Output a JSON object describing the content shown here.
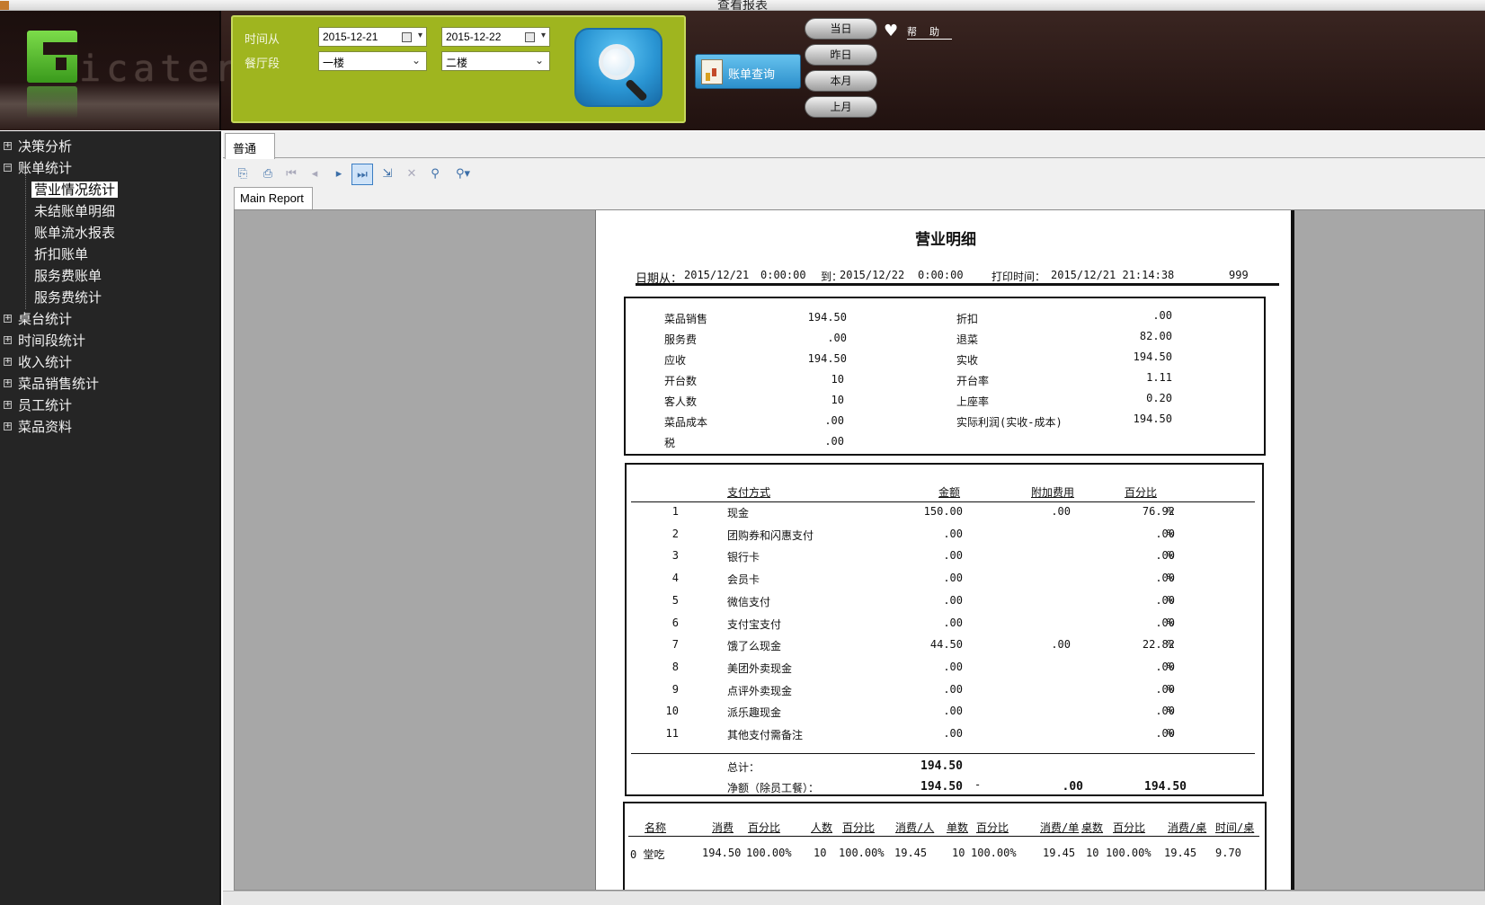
{
  "window": {
    "title": "查看报表"
  },
  "logo": {
    "text": "icater"
  },
  "filters": {
    "time_from_label": "时间从",
    "date_from": "2015-12-21",
    "date_to": "2015-12-22",
    "section_label": "餐厅段",
    "section_from": "一楼",
    "section_to": "二楼"
  },
  "buttons": {
    "bill_query": "账单查询",
    "today": "当日",
    "yesterday": "昨日",
    "this_month": "本月",
    "last_month": "上月",
    "help": "帮助"
  },
  "sidebar": {
    "items": [
      {
        "label": "决策分析",
        "expander": "+"
      },
      {
        "label": "账单统计",
        "expander": "−"
      },
      {
        "label": "营业情况统计"
      },
      {
        "label": "未结账单明细"
      },
      {
        "label": "账单流水报表"
      },
      {
        "label": "折扣账单"
      },
      {
        "label": "服务费账单"
      },
      {
        "label": "服务费统计"
      },
      {
        "label": "桌台统计",
        "expander": "+"
      },
      {
        "label": "时间段统计",
        "expander": "+"
      },
      {
        "label": "收入统计",
        "expander": "+"
      },
      {
        "label": "菜品销售统计",
        "expander": "+"
      },
      {
        "label": "员工统计",
        "expander": "+"
      },
      {
        "label": "菜品资料",
        "expander": "+"
      }
    ]
  },
  "main": {
    "tab": "普通",
    "report_tab": "Main Report"
  },
  "report": {
    "title": "营业明细",
    "date_from_label": "日期从：",
    "date_from": "2015/12/21",
    "time_from": "0:00:00",
    "date_to_label": "到：",
    "date_to": "2015/12/22",
    "time_to": "0:00:00",
    "print_label": "打印时间：",
    "print_time": "2015/12/21 21:14:38",
    "code": "999",
    "summary": {
      "left": [
        {
          "label": "菜品销售",
          "value": "194.50"
        },
        {
          "label": "服务费",
          "value": ".00"
        },
        {
          "label": "应收",
          "value": "194.50"
        },
        {
          "label": "开台数",
          "value": "10"
        },
        {
          "label": "客人数",
          "value": "10"
        },
        {
          "label": "菜品成本",
          "value": ".00"
        },
        {
          "label": "税",
          "value": ".00"
        }
      ],
      "right": [
        {
          "label": "折扣",
          "value": ".00"
        },
        {
          "label": "退菜",
          "value": "82.00"
        },
        {
          "label": "实收",
          "value": "194.50"
        },
        {
          "label": "开台率",
          "value": "1.11"
        },
        {
          "label": "上座率",
          "value": "0.20"
        },
        {
          "label": "实际利润(实收-成本)",
          "value": "194.50"
        }
      ]
    },
    "payments": {
      "headers": {
        "method": "支付方式",
        "amount": "金额",
        "extra": "附加费用",
        "percent": "百分比"
      },
      "rows": [
        {
          "no": "1",
          "method": "现金",
          "amount": "150.00",
          "extra": ".00",
          "percent": "76.92",
          "unit": "%"
        },
        {
          "no": "2",
          "method": "团购券和闪惠支付",
          "amount": ".00",
          "extra": "",
          "percent": ".00",
          "unit": "%"
        },
        {
          "no": "3",
          "method": "银行卡",
          "amount": ".00",
          "extra": "",
          "percent": ".00",
          "unit": "%"
        },
        {
          "no": "4",
          "method": "会员卡",
          "amount": ".00",
          "extra": "",
          "percent": ".00",
          "unit": "%"
        },
        {
          "no": "5",
          "method": "微信支付",
          "amount": ".00",
          "extra": "",
          "percent": ".00",
          "unit": "%"
        },
        {
          "no": "6",
          "method": "支付宝支付",
          "amount": ".00",
          "extra": "",
          "percent": ".00",
          "unit": "%"
        },
        {
          "no": "7",
          "method": "饿了么现金",
          "amount": "44.50",
          "extra": ".00",
          "percent": "22.82",
          "unit": "%"
        },
        {
          "no": "8",
          "method": "美团外卖现金",
          "amount": ".00",
          "extra": "",
          "percent": ".00",
          "unit": "%"
        },
        {
          "no": "9",
          "method": "点评外卖现金",
          "amount": ".00",
          "extra": "",
          "percent": ".00",
          "unit": "%"
        },
        {
          "no": "10",
          "method": "派乐趣现金",
          "amount": ".00",
          "extra": "",
          "percent": ".00",
          "unit": "%"
        },
        {
          "no": "11",
          "method": "其他支付需备注",
          "amount": ".00",
          "extra": "",
          "percent": ".00",
          "unit": "%"
        }
      ],
      "total_label": "总计：",
      "total_amount": "194.50",
      "net_label": "净额（除员工餐）：",
      "net_amount": "194.50",
      "net_dash": "-",
      "net_extra": ".00",
      "net_percent": "194.50"
    },
    "sections": {
      "headers": [
        "名称",
        "消费",
        "百分比",
        "人数",
        "百分比",
        "消费/人",
        "单数",
        "百分比",
        "消费/单",
        "桌数",
        "百分比",
        "消费/桌",
        "时间/桌"
      ],
      "row": [
        "0 堂吃",
        "194.50",
        "100.00%",
        "10",
        "100.00%",
        "19.45",
        "10",
        "100.00%",
        "19.45",
        "10",
        "100.00%",
        "19.45",
        "9.70"
      ]
    }
  }
}
